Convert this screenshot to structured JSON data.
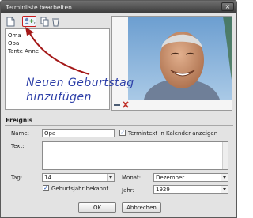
{
  "window": {
    "title": "Terminliste bearbeiten",
    "close_symbol": "×"
  },
  "toolbar": {
    "icons": [
      "new-document-icon",
      "add-birthday-icon",
      "copy-icon",
      "delete-icon"
    ]
  },
  "people_list": {
    "items": [
      "Oma",
      "Opa",
      "Tante Anne"
    ],
    "selected": "Opa"
  },
  "annotation": {
    "line1": "Neuen Geburtstag",
    "line2": "hinzufügen"
  },
  "photo": {
    "description_icon": "portrait-photo-icon",
    "tools": [
      "minus-icon",
      "remove-photo-icon"
    ]
  },
  "event": {
    "section_title": "Ereignis",
    "name_label": "Name:",
    "name_value": "Opa",
    "show_in_calendar_label": "Termintext in Kalender anzeigen",
    "show_in_calendar_checked": true,
    "text_label": "Text:",
    "text_value": "",
    "day_label": "Tag:",
    "day_value": "14",
    "month_label": "Monat:",
    "month_value": "Dezember",
    "year_known_label": "Geburtsjahr bekannt",
    "year_known_checked": true,
    "year_label": "Jahr:",
    "year_value": "1929"
  },
  "buttons": {
    "ok": "OK",
    "cancel": "Abbrechen"
  },
  "colors": {
    "annotation": "#2d3fa8",
    "highlight_arrow": "#a41818",
    "titlebar": "#4a4a4a"
  }
}
